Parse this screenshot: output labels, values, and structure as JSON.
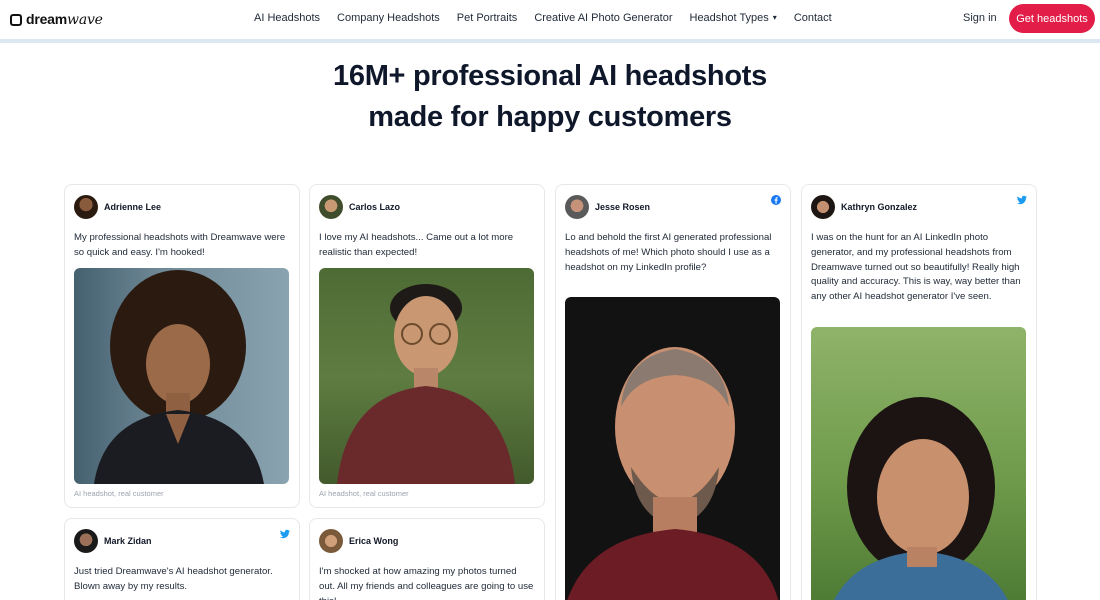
{
  "header": {
    "brand_prefix": "dream",
    "brand_suffix": "wave",
    "nav": [
      "AI Headshots",
      "Company Headshots",
      "Pet Portraits",
      "Creative AI Photo Generator",
      "Headshot Types",
      "Contact"
    ],
    "signin": "Sign in",
    "cta": "Get headshots"
  },
  "hero": {
    "line1": "16M+ professional AI headshots",
    "line2": "made for happy customers"
  },
  "cards": [
    {
      "name": "Adrienne Lee",
      "text": "My professional headshots with Dreamwave were so quick and easy. I'm hooked!",
      "caption": "AI headshot, real customer",
      "social": ""
    },
    {
      "name": "Carlos Lazo",
      "text": "I love my AI headshots... Came out a lot more realistic than expected!",
      "caption": "AI headshot, real customer",
      "social": ""
    },
    {
      "name": "Jesse Rosen",
      "text": "Lo and behold the first AI generated professional headshots of me! Which photo should I use as a headshot on my LinkedIn profile?",
      "caption": "",
      "social": "facebook-icon"
    },
    {
      "name": "Kathryn Gonzalez",
      "text": "I was on the hunt for an AI LinkedIn photo generator, and my professional headshots from Dreamwave turned out so beautifully! Really high quality and accuracy. This is way, way better than any other AI headshot generator I've seen.",
      "caption": "",
      "social": "twitter-icon"
    },
    {
      "name": "Mark Zidan",
      "text": "Just tried Dreamwave's AI headshot generator. Blown away by my results.",
      "caption": "",
      "social": "twitter-icon"
    },
    {
      "name": "Erica Wong",
      "text": "I'm shocked at how amazing my photos turned out. All my friends and colleagues are going to use this!",
      "caption": "",
      "social": ""
    }
  ],
  "colors": {
    "accent": "#e11d48",
    "facebook": "#1877f2",
    "twitter": "#1d9bf0"
  }
}
